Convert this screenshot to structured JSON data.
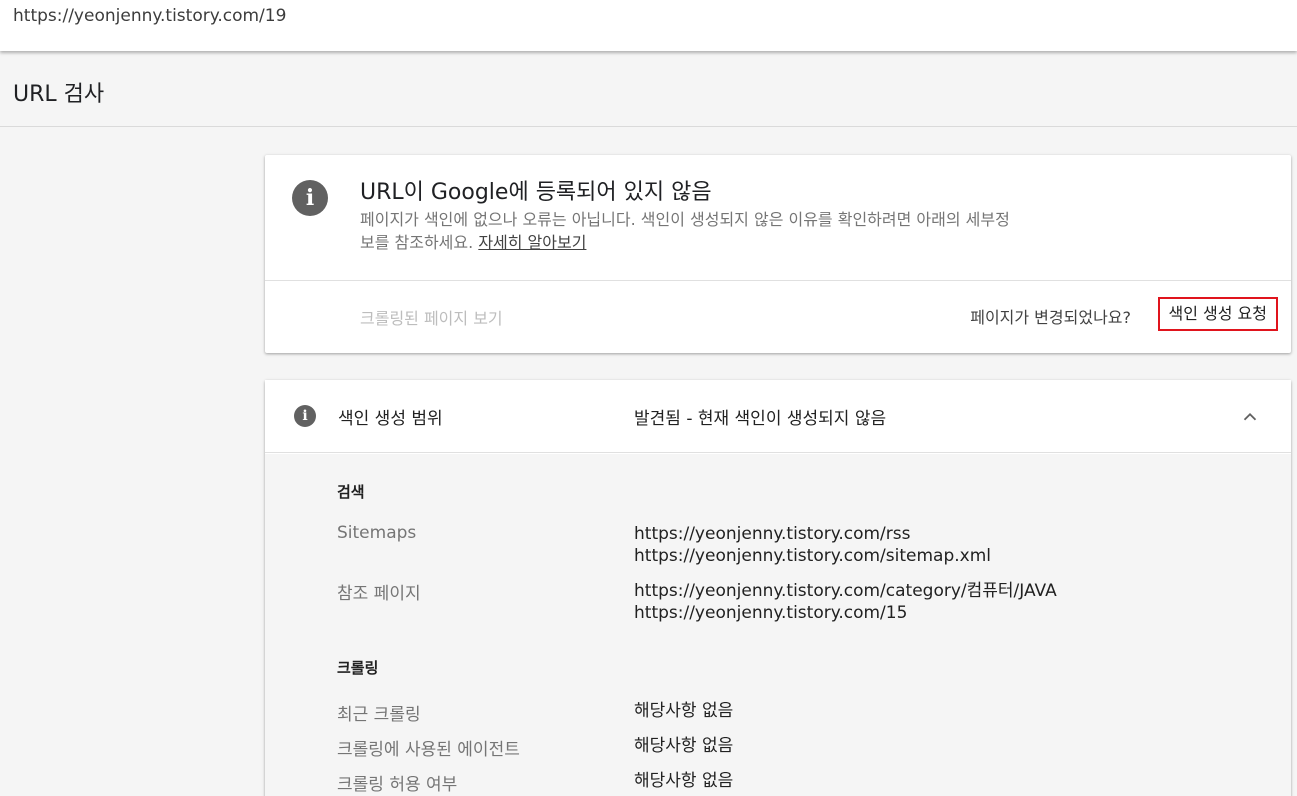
{
  "url_bar": {
    "url": "https://yeonjenny.tistory.com/19"
  },
  "page": {
    "title": "URL 검사"
  },
  "status_card": {
    "title": "URL이 Google에 등록되어 있지 않음",
    "description": "페이지가 색인에 없으나 오류는 아닙니다. 색인이 생성되지 않은 이유를 확인하려면 아래의 세부정보를 참조하세요.",
    "learn_more": "자세히 알아보기",
    "view_crawled": "크롤링된 페이지 보기",
    "changed_question": "페이지가 변경되었나요?",
    "request_indexing": "색인 생성 요청",
    "highlight_color": "#e0141d"
  },
  "coverage": {
    "label": "색인 생성 범위",
    "status": "발견됨 - 현재 색인이 생성되지 않음",
    "sections": {
      "search": {
        "heading": "검색",
        "sitemaps_label": "Sitemaps",
        "sitemaps": [
          "https://yeonjenny.tistory.com/rss",
          "https://yeonjenny.tistory.com/sitemap.xml"
        ],
        "referring_label": "참조 페이지",
        "referring": [
          "https://yeonjenny.tistory.com/category/컴퓨터/JAVA",
          "https://yeonjenny.tistory.com/15"
        ]
      },
      "crawl": {
        "heading": "크롤링",
        "last_crawl_label": "최근 크롤링",
        "last_crawl_value": "해당사항 없음",
        "agent_label": "크롤링에 사용된 에이전트",
        "agent_value": "해당사항 없음",
        "allowed_label": "크롤링 허용 여부",
        "allowed_value": "해당사항 없음"
      }
    }
  },
  "icons": {
    "info": "info-icon",
    "collapse": "chevron-up-icon"
  }
}
